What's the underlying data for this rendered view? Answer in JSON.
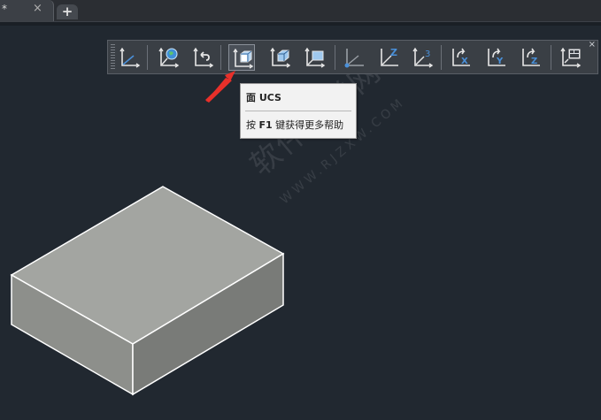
{
  "tabs": {
    "active_title": "*",
    "close_glyph": "×",
    "add_glyph": "+"
  },
  "toolbar": {
    "close_glyph": "×",
    "buttons": [
      {
        "name": "ucs",
        "icon": "ucs-icon"
      },
      {
        "name": "ucs-world",
        "icon": "ucs-world-icon"
      },
      {
        "name": "ucs-previous",
        "icon": "ucs-previous-icon"
      },
      {
        "name": "ucs-face",
        "icon": "ucs-face-icon",
        "active": true
      },
      {
        "name": "ucs-object",
        "icon": "ucs-object-icon"
      },
      {
        "name": "ucs-view",
        "icon": "ucs-view-icon"
      },
      {
        "name": "ucs-origin",
        "icon": "ucs-origin-icon"
      },
      {
        "name": "ucs-z-axis",
        "icon": "ucs-z-axis-icon",
        "label": "Z"
      },
      {
        "name": "ucs-3point",
        "icon": "ucs-3point-icon",
        "label": "3"
      },
      {
        "name": "ucs-rotate-x",
        "icon": "ucs-rotate-x-icon",
        "label": "X"
      },
      {
        "name": "ucs-rotate-y",
        "icon": "ucs-rotate-y-icon",
        "label": "Y"
      },
      {
        "name": "ucs-rotate-z",
        "icon": "ucs-rotate-z-icon",
        "label": "Z"
      },
      {
        "name": "ucs-apply",
        "icon": "ucs-apply-icon"
      }
    ]
  },
  "tooltip": {
    "title": "面 UCS",
    "help_prefix": "按 ",
    "help_key": "F1",
    "help_suffix": " 键获得更多帮助"
  },
  "watermark": {
    "text": "软件自学网",
    "sub": "WWW.RJZXW.COM"
  },
  "colors": {
    "background": "#212830",
    "box_top": "#a3a5a1",
    "box_left": "#8d8f8b",
    "box_right": "#797b78",
    "arrow": "#e8302a",
    "icon_blue": "#4a90d9"
  }
}
